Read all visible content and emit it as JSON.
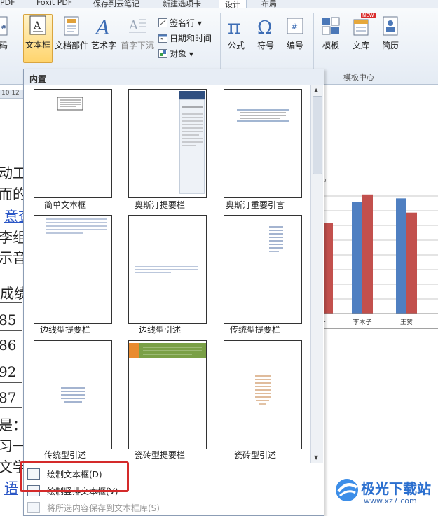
{
  "tabs": [
    "PDF",
    "Foxit PDF",
    "保存到云笔记",
    "新建选项卡",
    "设计",
    "布局"
  ],
  "ribbon": {
    "left_partial_label": "码",
    "textbox_label": "文本框",
    "docparts_label": "文档部件",
    "wordart_label": "艺术字",
    "dropcap_label": "首字下沉",
    "signature_line": "签名行",
    "datetime": "日期和时间",
    "object": "对象",
    "formula_label": "公式",
    "symbol_label": "符号",
    "number_label": "编号",
    "template_label": "模板",
    "library_label": "文库",
    "resume_label": "简历",
    "new_badge": "NEW",
    "template_center_group": "模板中心"
  },
  "ruler": {
    "marks": "10  12"
  },
  "document": {
    "lines": [
      "动工具",
      "而的大",
      "意查",
      "李组成",
      "示音大",
      "成绩",
      "85",
      "86",
      "92",
      "87",
      "是：",
      "习一",
      "文学",
      "语"
    ],
    "chart": {
      "labels": [
        "一",
        "李木子",
        "王贺"
      ]
    }
  },
  "panel": {
    "header": "内置",
    "tiles": [
      {
        "label": "简单文本框"
      },
      {
        "label": "奥斯汀提要栏"
      },
      {
        "label": "奥斯汀重要引言"
      },
      {
        "label": "边线型提要栏"
      },
      {
        "label": "边线型引述"
      },
      {
        "label": "传统型提要栏"
      },
      {
        "label": "传统型引述"
      },
      {
        "label": "瓷砖型提要栏"
      },
      {
        "label": "瓷砖型引述"
      }
    ],
    "menu": {
      "draw_textbox": "绘制文本框(D)",
      "draw_vertical_textbox": "绘制竖排文本框(V)",
      "save_selection": "将所选内容保存到文本框库(S)"
    }
  },
  "watermark": {
    "brand": "极光下载站",
    "url": "www.xz7.com"
  },
  "chart_data": {
    "type": "bar",
    "categories": [
      "一",
      "李木子",
      "王贺"
    ],
    "series": [
      {
        "values": [
          null,
          86,
          89
        ]
      },
      {
        "values": [
          70,
          92,
          78
        ]
      }
    ],
    "colors": [
      "#4f7fc1",
      "#c2504d"
    ]
  }
}
